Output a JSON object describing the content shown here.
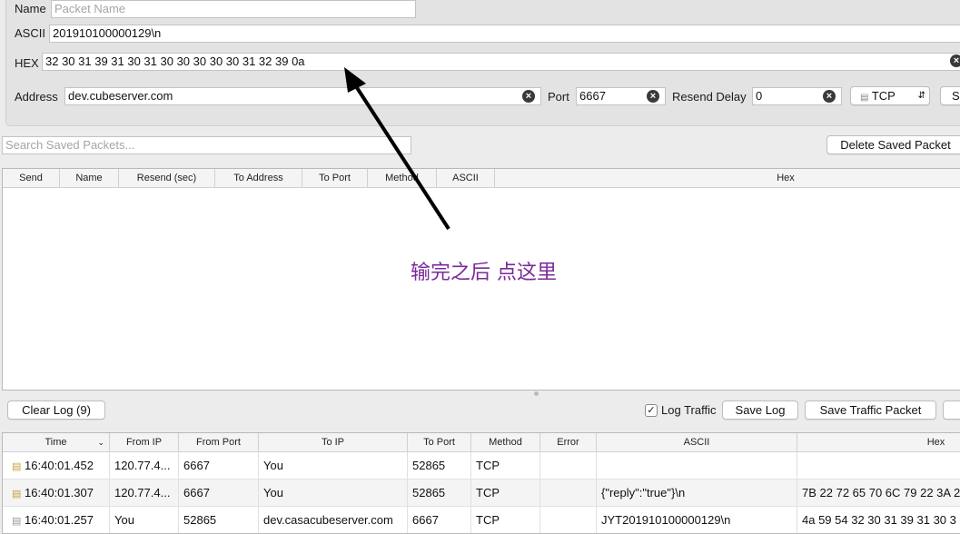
{
  "form": {
    "name_label": "Name",
    "name_placeholder": "Packet Name",
    "ascii_label": "ASCII",
    "ascii_value": "201910100000129\\n",
    "hex_label": "HEX",
    "hex_value": "32 30 31 39 31 30 31 30 30 30 30 30 31 32 39 0a",
    "address_label": "Address",
    "address_value": "dev.cubeserver.com",
    "port_label": "Port",
    "port_value": "6667",
    "resend_label": "Resend Delay",
    "resend_value": "0",
    "protocol_value": "TCP",
    "send_button_partial": "S"
  },
  "saved": {
    "search_placeholder": "Search Saved Packets...",
    "delete_button": "Delete Saved Packet",
    "columns": [
      "Send",
      "Name",
      "Resend (sec)",
      "To Address",
      "To Port",
      "Method",
      "ASCII",
      "Hex"
    ]
  },
  "annotation_text": "输完之后 点这里",
  "log": {
    "clear_button": "Clear Log (9)",
    "log_traffic_label": "Log Traffic",
    "log_traffic_checked": true,
    "save_log_button": "Save Log",
    "save_traffic_button": "Save Traffic Packet",
    "columns": [
      "Time",
      "From IP",
      "From Port",
      "To IP",
      "To Port",
      "Method",
      "Error",
      "ASCII",
      "Hex"
    ],
    "rows": [
      {
        "time": "16:40:01.452",
        "from_ip": "120.77.4...",
        "from_port": "6667",
        "to_ip": "You",
        "to_port": "52865",
        "method": "TCP",
        "error": "",
        "ascii": "",
        "hex": ""
      },
      {
        "time": "16:40:01.307",
        "from_ip": "120.77.4...",
        "from_port": "6667",
        "to_ip": "You",
        "to_port": "52865",
        "method": "TCP",
        "error": "",
        "ascii": "{\"reply\":\"true\"}\\n",
        "hex": "7B 22 72 65 70 6C 79 22 3A 2"
      },
      {
        "time": "16:40:01.257",
        "from_ip": "You",
        "from_port": "52865",
        "to_ip": "dev.casacubeserver.com",
        "to_port": "6667",
        "method": "TCP",
        "error": "",
        "ascii": "JYT201910100000129\\n",
        "hex": "4a 59 54 32 30 31 39 31 30 3"
      }
    ]
  }
}
